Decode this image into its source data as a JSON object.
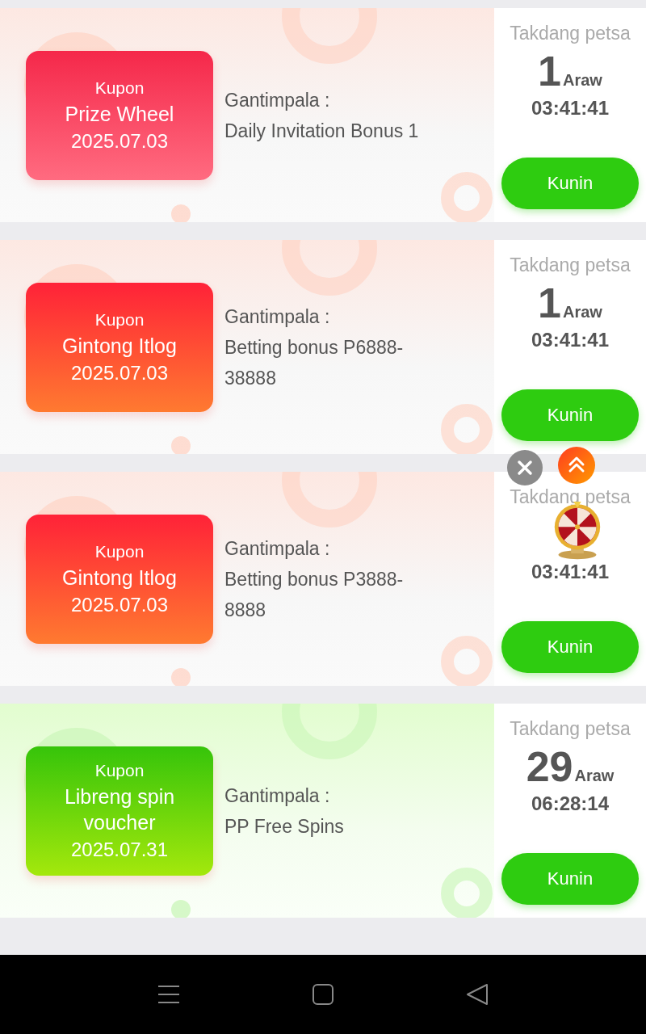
{
  "coupons": [
    {
      "kind": "pink",
      "label": "Kupon",
      "name": "Prize Wheel",
      "date": "2025.07.03",
      "source_label": "Gantimpala :",
      "source": "Daily Invitation Bonus 1",
      "deadline_label": "Takdang petsa",
      "days": "1",
      "days_unit": "Araw",
      "time": "03:41:41",
      "button": "Kunin"
    },
    {
      "kind": "red",
      "label": "Kupon",
      "name": "Gintong Itlog",
      "date": "2025.07.03",
      "source_label": "Gantimpala :",
      "source": "Betting bonus P6888-38888",
      "deadline_label": "Takdang petsa",
      "days": "1",
      "days_unit": "Araw",
      "time": "03:41:41",
      "button": "Kunin"
    },
    {
      "kind": "red",
      "label": "Kupon",
      "name": "Gintong Itlog",
      "date": "2025.07.03",
      "source_label": "Gantimpala :",
      "source": "Betting bonus P3888-8888",
      "deadline_label": "Takdang petsa",
      "time": "03:41:41",
      "button": "Kunin"
    },
    {
      "kind": "green",
      "label": "Kupon",
      "name": "Libreng spin voucher",
      "date": "2025.07.31",
      "source_label": "Gantimpala :",
      "source": "PP Free Spins",
      "deadline_label": "Takdang petsa",
      "days": "29",
      "days_unit": "Araw",
      "time": "06:28:14",
      "button": "Kunin"
    }
  ]
}
